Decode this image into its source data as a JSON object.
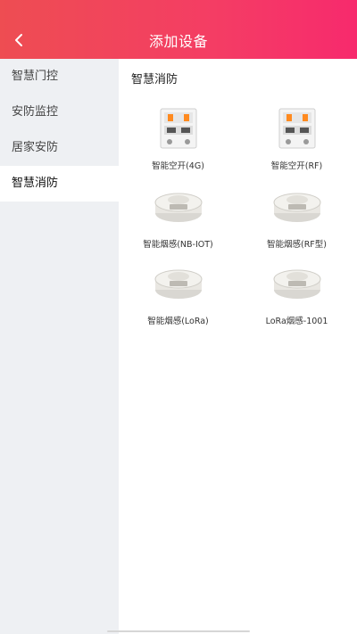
{
  "header": {
    "title": "添加设备",
    "back_icon": "chevron-left-icon"
  },
  "sidebar": {
    "items": [
      {
        "label": "智慧门控",
        "active": false
      },
      {
        "label": "安防监控",
        "active": false
      },
      {
        "label": "居家安防",
        "active": false
      },
      {
        "label": "智慧消防",
        "active": true
      }
    ]
  },
  "content": {
    "section_title": "智慧消防",
    "devices": [
      {
        "label": "智能空开(4G)",
        "icon": "circuit-breaker-icon"
      },
      {
        "label": "智能空开(RF)",
        "icon": "circuit-breaker-icon"
      },
      {
        "label": "智能烟感(NB-IOT)",
        "icon": "smoke-detector-icon"
      },
      {
        "label": "智能烟感(RF型)",
        "icon": "smoke-detector-icon"
      },
      {
        "label": "智能烟感(LoRa)",
        "icon": "smoke-detector-icon"
      },
      {
        "label": "LoRa烟感-1001",
        "icon": "smoke-detector-icon"
      }
    ]
  },
  "colors": {
    "header_start": "#ee4d52",
    "header_end": "#f72a6d",
    "sidebar_bg": "#eef0f3"
  }
}
